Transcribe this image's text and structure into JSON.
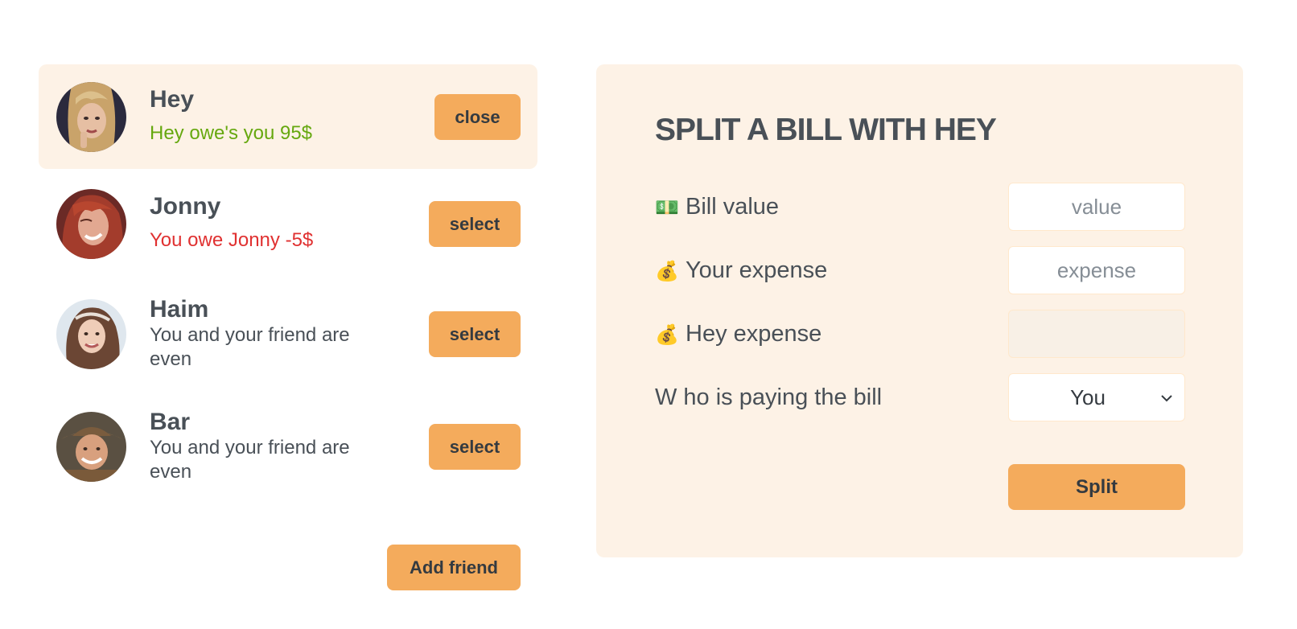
{
  "friends": [
    {
      "name": "Hey",
      "status": "Hey owe's you 95$",
      "button": "close"
    },
    {
      "name": "Jonny",
      "status": "You owe Jonny -5$",
      "button": "select"
    },
    {
      "name": "Haim",
      "status": "You and your friend are even",
      "button": "select"
    },
    {
      "name": "Bar",
      "status": "You and your friend are even",
      "button": "select"
    }
  ],
  "add_friend_label": "Add friend",
  "split": {
    "title": "SPLIT A BILL WITH HEY",
    "bill_value": {
      "icon": "💵",
      "label": "Bill value",
      "placeholder": "value"
    },
    "your_expense": {
      "icon": "💰",
      "label": "Your expense",
      "placeholder": "expense"
    },
    "friend_expense": {
      "icon": "💰",
      "label": "Hey expense",
      "value": ""
    },
    "payer": {
      "label": "W ho is paying the bill",
      "selected": "You"
    },
    "submit_label": "Split"
  },
  "colors": {
    "accent": "#f4ab5c",
    "panel": "#fdf2e6",
    "positive": "#66a80f",
    "negative": "#e03131",
    "text": "#495057"
  }
}
